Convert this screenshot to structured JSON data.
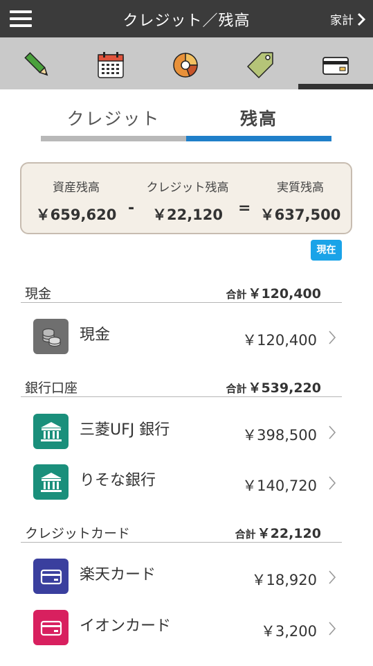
{
  "header": {
    "title": "クレジット／残高",
    "right_link": "家計"
  },
  "toolbar": {
    "items": [
      "pencil-icon",
      "calendar-icon",
      "pie-chart-icon",
      "tag-icon",
      "card-icon"
    ],
    "active": "card-icon"
  },
  "tabs": {
    "credit": "クレジット",
    "balance": "残高",
    "active": "balance"
  },
  "summary": {
    "assets_label": "資産残高",
    "assets_value": "￥659,620",
    "minus": "-",
    "credit_label": "クレジット残高",
    "credit_value": "￥22,120",
    "equals": "=",
    "net_label": "実質残高",
    "net_value": "￥637,500"
  },
  "now_badge": "現在",
  "total_prefix": "合計",
  "sections": [
    {
      "title": "現金",
      "total": "￥120,400",
      "items": [
        {
          "name": "現金",
          "amount": "￥120,400",
          "icon": "coins-icon",
          "color": "#6f6f6f"
        }
      ]
    },
    {
      "title": "銀行口座",
      "total": "￥539,220",
      "items": [
        {
          "name": "三菱UFJ 銀行",
          "amount": "￥398,500",
          "icon": "bank-icon",
          "color": "#1a8f7b"
        },
        {
          "name": "りそな銀行",
          "amount": "￥140,720",
          "icon": "bank-icon",
          "color": "#1a8f7b"
        }
      ]
    },
    {
      "title": "クレジットカード",
      "total": "￥22,120",
      "items": [
        {
          "name": "楽天カード",
          "amount": "￥18,920",
          "icon": "credit-card-icon",
          "color": "#3a3f9e"
        },
        {
          "name": "イオンカード",
          "amount": "￥3,200",
          "icon": "credit-card-icon",
          "color": "#d8205f"
        }
      ]
    }
  ],
  "colors": {
    "header_bg": "#3b3b3b",
    "toolbar_bg": "#c9c9c9",
    "tab_active": "#1f7fc9",
    "tab_inactive": "#b8b8b8",
    "badge": "#1aa3e8"
  }
}
